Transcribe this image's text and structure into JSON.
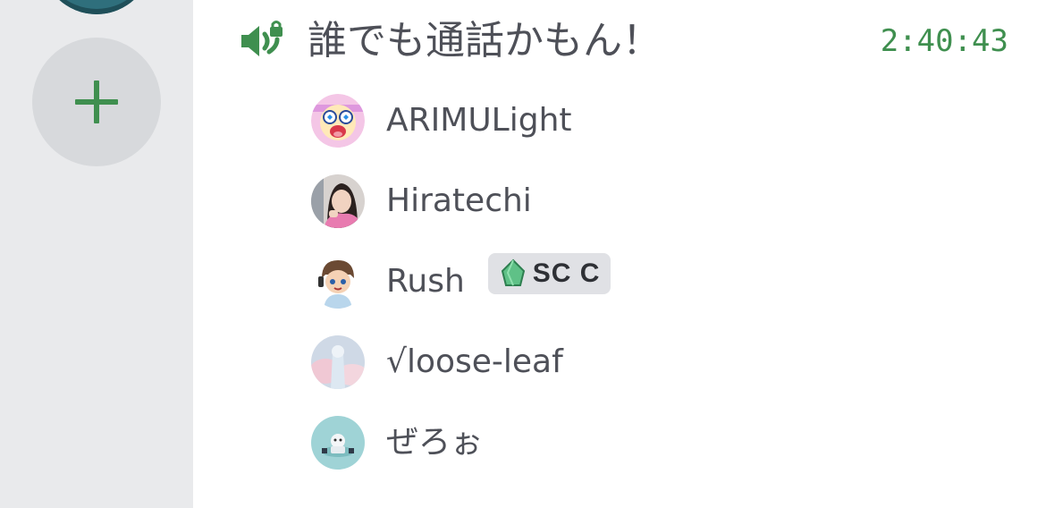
{
  "channel": {
    "name": "誰でも通話かもん！",
    "elapsed": "2:40:43"
  },
  "rail": {
    "add_server_label": "+"
  },
  "members": [
    {
      "name": "ARIMULight"
    },
    {
      "name": "Hiratechi"
    },
    {
      "name": "Rush",
      "tag": {
        "label": "SC C",
        "icon": "green-gem-icon"
      }
    },
    {
      "name": "√loose-leaf"
    },
    {
      "name": "ぜろぉ"
    }
  ],
  "colors": {
    "rail_bg": "#e9eaec",
    "add_button_bg": "#d7d9dc",
    "accent_green": "#3f8f4f",
    "text": "#4e5058",
    "tag_bg": "#e0e1e5"
  },
  "icons": {
    "channel": "voice-channel-locked-icon",
    "add_server": "plus-icon"
  }
}
